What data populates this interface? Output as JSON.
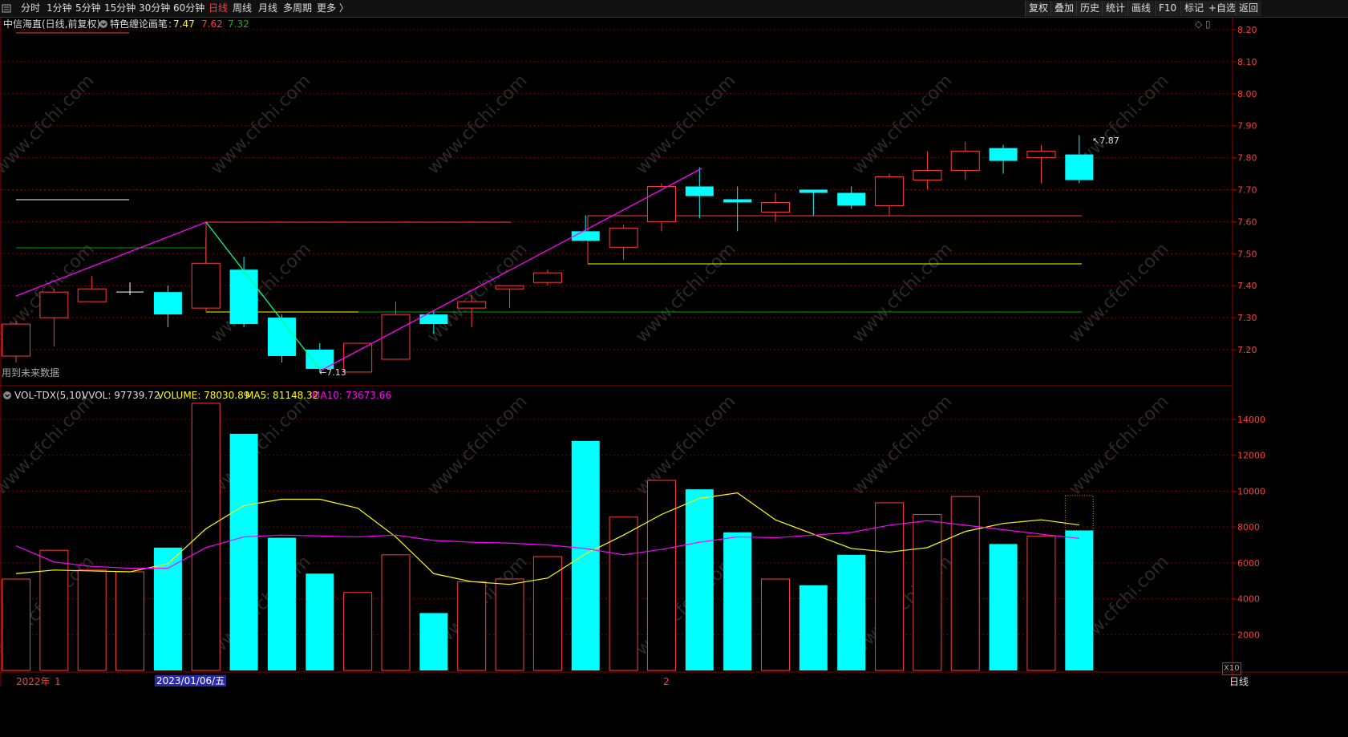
{
  "toolbar": {
    "menu_icon": "menu-icon",
    "periods": [
      "分时",
      "1分钟",
      "5分钟",
      "15分钟",
      "30分钟",
      "60分钟",
      "日线",
      "周线",
      "月线",
      "多周期",
      "更多 〉"
    ],
    "active_period": "日线",
    "right_buttons": [
      "复权",
      "叠加",
      "历史",
      "统计",
      "画线",
      "F10",
      "+自选",
      "标记",
      "返回"
    ]
  },
  "main_panel": {
    "stock_title": "中信海直(日线,前复权)",
    "indicator_name": "特色缠论画笔",
    "indicator_values": [
      {
        "value": "7.47",
        "color": "#ffff00"
      },
      {
        "value": "7.62",
        "color": "#ff3b3b"
      },
      {
        "value": "7.32",
        "color": "#00c000"
      }
    ],
    "future_data_note": "用到未来数据",
    "high_label": "7.87",
    "low_label": "7.13",
    "price_axis": [
      "8.20",
      "8.10",
      "8.00",
      "7.90",
      "7.80",
      "7.70",
      "7.60",
      "7.50",
      "7.40",
      "7.30",
      "7.20"
    ]
  },
  "volume_panel": {
    "indicator": "VOL-TDX(5,10)",
    "vvol": "VVOL: 97739.72",
    "volume": "VOLUME: 78030.89",
    "ma5": "MA5: 81148.32",
    "ma10": "MA10: 73673.66",
    "volume_axis": [
      "14000",
      "12000",
      "10000",
      "8000",
      "6000",
      "4000",
      "2000"
    ],
    "unit_label": "X10"
  },
  "date_axis": {
    "year_label": "2022年",
    "month1": "1",
    "selected_date": "2023/01/06/五",
    "month2": "2",
    "period_label": "日线"
  },
  "watermark": "www.cfchi.com",
  "colors": {
    "up": "#ff3b3b",
    "down": "#00ffff",
    "ma5": "#ffff00",
    "ma10": "#ff00ff",
    "pen": "#ff00ff"
  },
  "candles": [
    {
      "o": 7.18,
      "h": 7.29,
      "l": 7.16,
      "c": 7.28
    },
    {
      "o": 7.3,
      "h": 7.39,
      "l": 7.21,
      "c": 7.38
    },
    {
      "o": 7.35,
      "h": 7.43,
      "l": 7.35,
      "c": 7.39
    },
    {
      "o": 7.38,
      "h": 7.41,
      "l": 7.37,
      "c": 7.38
    },
    {
      "o": 7.38,
      "h": 7.4,
      "l": 7.27,
      "c": 7.31
    },
    {
      "o": 7.33,
      "h": 7.55,
      "l": 7.33,
      "c": 7.47
    },
    {
      "o": 7.45,
      "h": 7.49,
      "l": 7.27,
      "c": 7.28
    },
    {
      "o": 7.3,
      "h": 7.31,
      "l": 7.16,
      "c": 7.18
    },
    {
      "o": 7.2,
      "h": 7.22,
      "l": 7.13,
      "c": 7.14
    },
    {
      "o": 7.13,
      "h": 7.22,
      "l": 7.13,
      "c": 7.22
    },
    {
      "o": 7.17,
      "h": 7.35,
      "l": 7.17,
      "c": 7.31
    },
    {
      "o": 7.31,
      "h": 7.32,
      "l": 7.25,
      "c": 7.28
    },
    {
      "o": 7.33,
      "h": 7.37,
      "l": 7.27,
      "c": 7.35
    },
    {
      "o": 7.39,
      "h": 7.4,
      "l": 7.33,
      "c": 7.4
    },
    {
      "o": 7.41,
      "h": 7.45,
      "l": 7.4,
      "c": 7.44
    },
    {
      "o": 7.57,
      "h": 7.62,
      "l": 7.54,
      "c": 7.54
    },
    {
      "o": 7.52,
      "h": 7.59,
      "l": 7.48,
      "c": 7.58
    },
    {
      "o": 7.6,
      "h": 7.72,
      "l": 7.57,
      "c": 7.71
    },
    {
      "o": 7.71,
      "h": 7.77,
      "l": 7.61,
      "c": 7.68
    },
    {
      "o": 7.67,
      "h": 7.71,
      "l": 7.57,
      "c": 7.66
    },
    {
      "o": 7.63,
      "h": 7.69,
      "l": 7.6,
      "c": 7.66
    },
    {
      "o": 7.7,
      "h": 7.7,
      "l": 7.62,
      "c": 7.69
    },
    {
      "o": 7.69,
      "h": 7.71,
      "l": 7.64,
      "c": 7.65
    },
    {
      "o": 7.65,
      "h": 7.75,
      "l": 7.62,
      "c": 7.74
    },
    {
      "o": 7.73,
      "h": 7.82,
      "l": 7.7,
      "c": 7.76
    },
    {
      "o": 7.76,
      "h": 7.85,
      "l": 7.73,
      "c": 7.82
    },
    {
      "o": 7.83,
      "h": 7.84,
      "l": 7.75,
      "c": 7.79
    },
    {
      "o": 7.8,
      "h": 7.84,
      "l": 7.72,
      "c": 7.82
    },
    {
      "o": 7.81,
      "h": 7.87,
      "l": 7.72,
      "c": 7.73
    }
  ],
  "volumes": [
    5100,
    6700,
    5600,
    5500,
    6850,
    14900,
    13200,
    7400,
    5400,
    4350,
    6450,
    3200,
    4950,
    5100,
    6350,
    12800,
    8550,
    10600,
    10100,
    7700,
    5100,
    4750,
    6450,
    9350,
    8700,
    9700,
    7050,
    7500,
    7803
  ],
  "ma5_line": [
    5400,
    5600,
    5550,
    5500,
    5950,
    7900,
    9200,
    9550,
    9550,
    9050,
    7450,
    5400,
    4950,
    4800,
    5150,
    6500,
    7550,
    8700,
    9600,
    9900,
    8400,
    7600,
    6800,
    6600,
    6850,
    7750,
    8200,
    8400,
    8115
  ],
  "ma10_line": [
    6950,
    6050,
    5800,
    5700,
    5700,
    6850,
    7450,
    7550,
    7500,
    7450,
    7550,
    7250,
    7150,
    7100,
    7000,
    6800,
    6450,
    6750,
    7150,
    7450,
    7400,
    7550,
    7700,
    8100,
    8350,
    8100,
    7850,
    7600,
    7367
  ]
}
